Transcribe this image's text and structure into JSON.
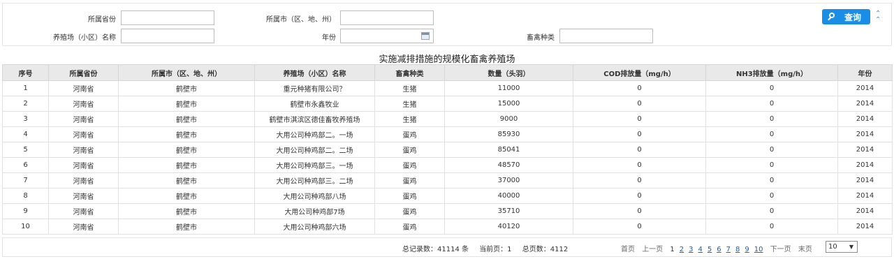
{
  "filters": {
    "province_label": "所属省份",
    "province_value": "",
    "city_label": "所属市（区、地、州）",
    "city_value": "",
    "farm_label": "养殖场（小区）名称",
    "farm_value": "",
    "year_label": "年份",
    "year_value": "",
    "livestock_label": "畜禽种类",
    "livestock_value": "",
    "search_label": "查询"
  },
  "table": {
    "title": "实施减排措施的规模化畜禽养殖场",
    "columns": [
      "序号",
      "所属省份",
      "所属市（区、地、州）",
      "养殖场（小区）名称",
      "畜禽种类",
      "数量（头羽）",
      "COD排放量（mg/h）",
      "NH3排放量（mg/h）",
      "年份"
    ],
    "rows": [
      [
        "1",
        "河南省",
        "鹤壁市",
        "重元种猪有限公司？",
        "生猪",
        "11000",
        "0",
        "0",
        "2014"
      ],
      [
        "2",
        "河南省",
        "鹤壁市",
        "鹤壁市永鑫牧业",
        "生猪",
        "15000",
        "0",
        "0",
        "2014"
      ],
      [
        "3",
        "河南省",
        "鹤壁市",
        "鹤壁市淇滨区德佳畜牧养殖场",
        "生猪",
        "9000",
        "0",
        "0",
        "2014"
      ],
      [
        "4",
        "河南省",
        "鹤壁市",
        "大用公司种鸡部二。一场",
        "蛋鸡",
        "85930",
        "0",
        "0",
        "2014"
      ],
      [
        "5",
        "河南省",
        "鹤壁市",
        "大用公司种鸡部二。二场",
        "蛋鸡",
        "85041",
        "0",
        "0",
        "2014"
      ],
      [
        "6",
        "河南省",
        "鹤壁市",
        "大用公司种鸡部三。一场",
        "蛋鸡",
        "48570",
        "0",
        "0",
        "2014"
      ],
      [
        "7",
        "河南省",
        "鹤壁市",
        "大用公司种鸡部三。二场",
        "蛋鸡",
        "37000",
        "0",
        "0",
        "2014"
      ],
      [
        "8",
        "河南省",
        "鹤壁市",
        "大用公司种鸡部八场",
        "蛋鸡",
        "40000",
        "0",
        "0",
        "2014"
      ],
      [
        "9",
        "河南省",
        "鹤壁市",
        "大用公司种鸡部7场",
        "蛋鸡",
        "35710",
        "0",
        "0",
        "2014"
      ],
      [
        "10",
        "河南省",
        "鹤壁市",
        "大用公司种鸡部六场",
        "蛋鸡",
        "40120",
        "0",
        "0",
        "2014"
      ]
    ]
  },
  "pager": {
    "total_records": "总记录数：41114 条",
    "current_page": "当前页：1",
    "total_pages": "总页数：4112",
    "first": "首页",
    "prev": "上一页",
    "pages": [
      "1",
      "2",
      "3",
      "4",
      "5",
      "6",
      "7",
      "8",
      "9",
      "10"
    ],
    "next": "下一页",
    "last": "末页",
    "page_size": "10"
  },
  "colors": {
    "accent": "#1a8ee6",
    "header_bg": "#e9e9e9",
    "link": "#1a5fb4"
  }
}
